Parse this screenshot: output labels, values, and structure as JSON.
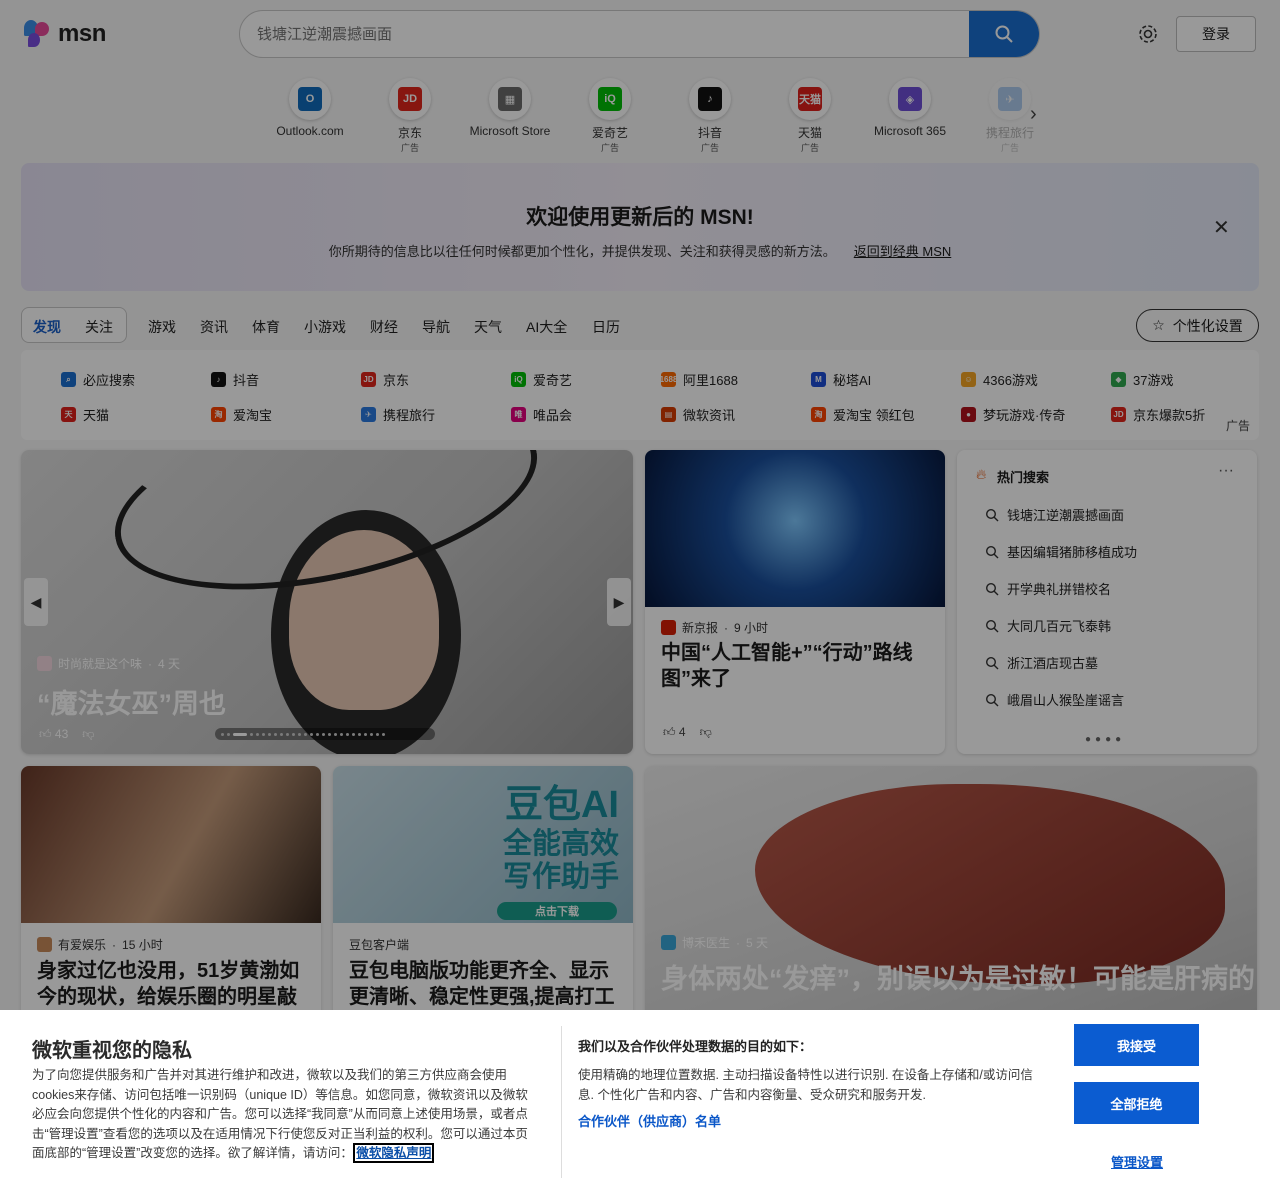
{
  "header": {
    "brand": "msn",
    "search_placeholder": "钱塘江逆潮震撼画面",
    "login_label": "登录"
  },
  "quick_links": [
    {
      "name": "Outlook.com",
      "ad": "",
      "icon": "outlook-icon",
      "color": "#0f6cbd",
      "glyph": "O"
    },
    {
      "name": "京东",
      "ad": "广告",
      "icon": "jd-icon",
      "color": "#e1251b",
      "glyph": "JD"
    },
    {
      "name": "Microsoft Store",
      "ad": "",
      "icon": "store-icon",
      "color": "#6b6b6b",
      "glyph": "▦"
    },
    {
      "name": "爱奇艺",
      "ad": "广告",
      "icon": "iqiyi-icon",
      "color": "#00be06",
      "glyph": "iQ"
    },
    {
      "name": "抖音",
      "ad": "广告",
      "icon": "douyin-icon",
      "color": "#111111",
      "glyph": "♪"
    },
    {
      "name": "天猫",
      "ad": "广告",
      "icon": "tmall-icon",
      "color": "#e0201b",
      "glyph": "天猫"
    },
    {
      "name": "Microsoft 365",
      "ad": "",
      "icon": "m365-icon",
      "color": "#6f4fd8",
      "glyph": "◈"
    },
    {
      "name": "携程旅行",
      "ad": "广告",
      "icon": "ctrip-icon",
      "color": "#2a7ae2",
      "glyph": "✈"
    }
  ],
  "banner": {
    "title": "欢迎使用更新后的 MSN!",
    "desc": "你所期待的信息比以往任何时候都更加个性化，并提供发现、关注和获得灵感的新方法。",
    "link": "返回到经典 MSN"
  },
  "nav": {
    "tabs": [
      "发现",
      "关注",
      "游戏",
      "资讯",
      "体育",
      "小游戏",
      "财经",
      "导航",
      "天气",
      "AI大全",
      "日历"
    ],
    "personalize": "个性化设置"
  },
  "shortcuts": [
    {
      "label": "必应搜索",
      "color": "#1a6fd1",
      "glyph": "⌕"
    },
    {
      "label": "抖音",
      "color": "#111111",
      "glyph": "♪"
    },
    {
      "label": "京东",
      "color": "#e1251b",
      "glyph": "JD"
    },
    {
      "label": "爱奇艺",
      "color": "#00be06",
      "glyph": "iQ"
    },
    {
      "label": "阿里1688",
      "color": "#ff6a00",
      "glyph": "1688"
    },
    {
      "label": "秘塔AI",
      "color": "#1d4ed8",
      "glyph": "M"
    },
    {
      "label": "4366游戏",
      "color": "#f5a623",
      "glyph": "☺"
    },
    {
      "label": "37游戏",
      "color": "#2fa84f",
      "glyph": "◆"
    },
    {
      "label": "天猫",
      "color": "#e0201b",
      "glyph": "天"
    },
    {
      "label": "爱淘宝",
      "color": "#ff4400",
      "glyph": "淘"
    },
    {
      "label": "携程旅行",
      "color": "#2a7ae2",
      "glyph": "✈"
    },
    {
      "label": "唯品会",
      "color": "#e4007f",
      "glyph": "唯"
    },
    {
      "label": "微软资讯",
      "color": "#d83b01",
      "glyph": "▤"
    },
    {
      "label": "爱淘宝 领红包",
      "color": "#ff4400",
      "glyph": "淘"
    },
    {
      "label": "梦玩游戏·传奇",
      "color": "#b1121b",
      "glyph": "●"
    },
    {
      "label": "京东爆款5折",
      "color": "#e1251b",
      "glyph": "JD"
    }
  ],
  "shortcuts_ad": "广告",
  "hero": {
    "source": "时尚就是这个味",
    "age": "4 天",
    "title": "“魔法女巫”周也",
    "likes": "43"
  },
  "ai_card": {
    "source": "新京报",
    "age": "9 小时",
    "title": "中国“人工智能+”“行动”路线图”来了",
    "likes": "4"
  },
  "hot": {
    "title": "热门搜索",
    "items": [
      "钱塘江逆潮震撼画面",
      "基因编辑猪肺移植成功",
      "开学典礼拼错校名",
      "大同几百元飞泰韩",
      "浙江酒店现古墓",
      "峨眉山人猴坠崖谣言"
    ]
  },
  "card1": {
    "source": "有爱娱乐",
    "age": "15 小时",
    "title": "身家过亿也没用，51岁黄渤如今的现状，给娱乐圈的明星敲"
  },
  "card2": {
    "source": "豆包客户端",
    "title": "豆包电脑版功能更齐全、显示更清晰、稳定性更强,提高打工",
    "promo": [
      "豆包AI",
      "全能高效",
      "写作助手"
    ],
    "promo_btn": "点击下载"
  },
  "liver": {
    "source": "博禾医生",
    "age": "5 天",
    "title": "身体两处“发痒”，别误以为是过敏！可能是肝病的“提示信号”"
  },
  "privacy": {
    "title": "微软重视您的隐私",
    "text": "为了向您提供服务和广告并对其进行维护和改进，微软以及我们的第三方供应商会使用 cookies来存储、访问包括唯一识别码（unique ID）等信息。如您同意，微软资讯以及微软必应会向您提供个性化的内容和广告。您可以选择“我同意”从而同意上述使用场景，或者点击“管理设置”查看您的选项以及在适用情况下行使您反对正当利益的权利。您可以通过本页面底部的“管理设置”改变您的选择。欲了解详情，请访问：",
    "link": "微软隐私声明",
    "purpose_title": "我们以及合作伙伴处理数据的目的如下：",
    "purpose_text": "使用精确的地理位置数据. 主动扫描设备特性以进行识别. 在设备上存储和/或访问信息. 个性化广告和内容、广告和内容衡量、受众研究和服务开发.",
    "partners": "合作伙伴（供应商）名单",
    "accept": "我接受",
    "reject": "全部拒绝",
    "manage": "管理设置"
  }
}
